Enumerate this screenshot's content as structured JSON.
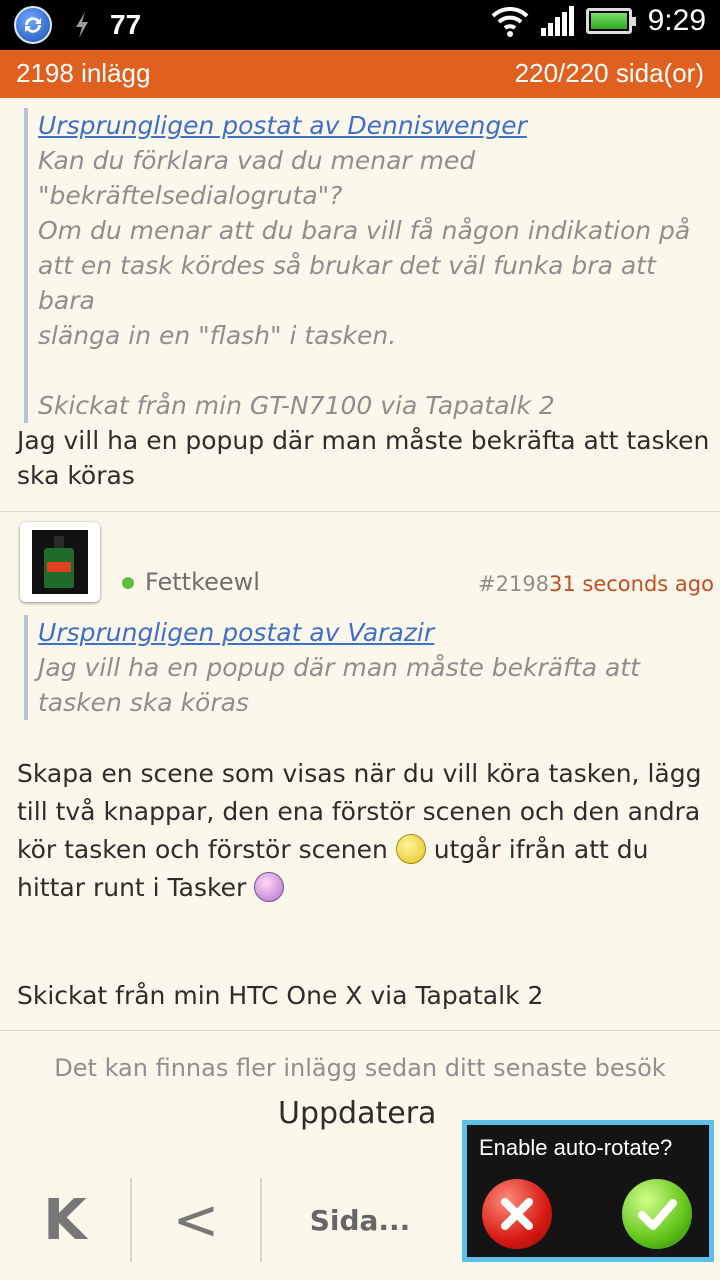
{
  "status_bar": {
    "notification_count": "77",
    "time": "9:29",
    "icons": [
      "sync-icon",
      "flash-icon",
      "wifi-icon",
      "signal-icon",
      "battery-icon"
    ]
  },
  "header": {
    "post_count": "2198 inlägg",
    "page_indicator": "220/220 sida(or)"
  },
  "post_1": {
    "quote_link": "Ursprungligen postat av Denniswenger",
    "quote_lines": [
      "Kan du förklara vad du menar med",
      "\"bekräftelsedialogruta\"?",
      "Om du menar att du bara vill få någon indikation på",
      "att en task kördes så brukar det väl funka bra att bara",
      "slänga in en \"flash\" i tasken."
    ],
    "quote_signature": "Skickat från min GT-N7100 via Tapatalk 2",
    "body_lines": [
      "Jag vill ha en popup där man måste bekräfta att tasken",
      "ska köras"
    ]
  },
  "post_2": {
    "username": "Fettkeewl",
    "post_number": "#2198",
    "time": "31 seconds ago",
    "quote_link": "Ursprungligen postat av Varazir",
    "quote_lines": [
      "Jag vill ha en popup där man måste bekräfta att",
      "tasken ska köras"
    ],
    "body_line_1": "Skapa en scene som visas när du vill köra tasken, lägg",
    "body_line_2": "till två knappar, den ena förstör scenen och den andra",
    "body_line_3a": "kör tasken och förstör scenen ",
    "body_line_3b": " utgår ifrån att du",
    "body_line_4": "hittar runt i Tasker ",
    "signature": "Skickat från min HTC One X via Tapatalk 2"
  },
  "footer": {
    "notice": "Det kan finnas fler inlägg sedan ditt senaste besök",
    "update_label": "Uppdatera"
  },
  "toolbar": {
    "first_label": "K",
    "prev_label": "<",
    "page_label": "Sida..."
  },
  "rotate_dialog": {
    "title": "Enable auto-rotate?"
  },
  "colors": {
    "header_bg": "#e0601f",
    "link": "#3f6fc9",
    "timestamp": "#c24d27",
    "online": "#5cc13d",
    "background": "#fbf7ea",
    "dialog_border": "#5cc0e8"
  }
}
